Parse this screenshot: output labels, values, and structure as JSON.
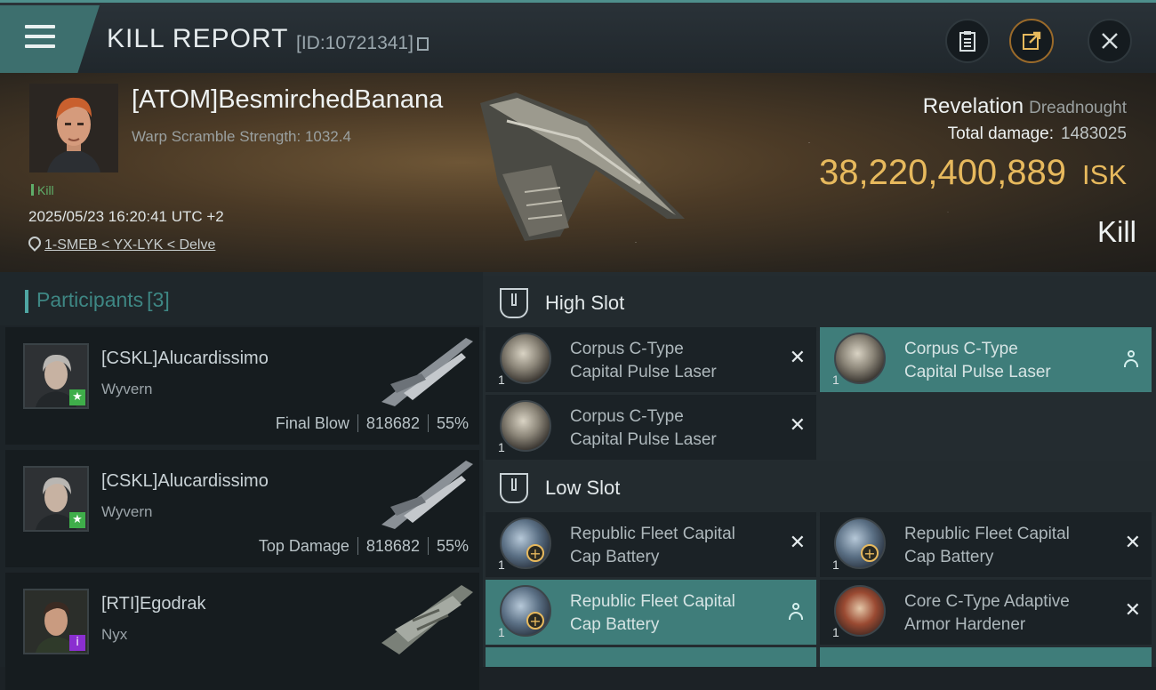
{
  "header": {
    "title": "KILL REPORT",
    "report_id": "[ID:10721341]"
  },
  "icons": {
    "menu": "hamburger-icon",
    "copy": "copy-icon",
    "clipboard": "clipboard-icon",
    "share": "share-icon",
    "close": "close-icon"
  },
  "victim": {
    "name": "[ATOM]BesmirchedBanana",
    "warp_scramble": "Warp Scramble Strength: 1032.4",
    "tag": "Kill",
    "timestamp": "2025/05/23 16:20:41 UTC +2",
    "location": "1-SMEB < YX-LYK < Delve",
    "ship": "Revelation",
    "ship_class": "Dreadnought",
    "total_damage_label": "Total damage:",
    "total_damage": "1483025",
    "isk_value": "38,220,400,889",
    "isk_unit": "ISK",
    "result": "Kill"
  },
  "participants": {
    "title": "Participants",
    "count": "[3]",
    "rows": [
      {
        "name": "[CSKL]Alucardissimo",
        "ship": "Wyvern",
        "role": "Final Blow",
        "damage": "818682",
        "percent": "55%",
        "badge": "★",
        "badge_color": "#3fae4a"
      },
      {
        "name": "[CSKL]Alucardissimo",
        "ship": "Wyvern",
        "role": "Top Damage",
        "damage": "818682",
        "percent": "55%",
        "badge": "★",
        "badge_color": "#3fae4a"
      },
      {
        "name": "[RTI]Egodrak",
        "ship": "Nyx",
        "badge": "i",
        "badge_color": "#8a2fd0"
      }
    ]
  },
  "fitting": {
    "high_slot": {
      "title": "High Slot",
      "modules": [
        {
          "line1": "Corpus C-Type",
          "line2": "Capital Pulse Laser",
          "qty": "1",
          "state": "destroyed"
        },
        {
          "line1": "Corpus C-Type",
          "line2": "Capital Pulse Laser",
          "qty": "1",
          "state": "dropped"
        },
        {
          "line1": "Corpus C-Type",
          "line2": "Capital Pulse Laser",
          "qty": "1",
          "state": "destroyed"
        }
      ]
    },
    "low_slot": {
      "title": "Low Slot",
      "modules": [
        {
          "line1": "Republic Fleet Capital",
          "line2": "Cap Battery",
          "qty": "1",
          "state": "destroyed"
        },
        {
          "line1": "Republic Fleet Capital",
          "line2": "Cap Battery",
          "qty": "1",
          "state": "destroyed"
        },
        {
          "line1": "Republic Fleet Capital",
          "line2": "Cap Battery",
          "qty": "1",
          "state": "dropped"
        },
        {
          "line1": "Core C-Type Adaptive",
          "line2": "Armor Hardener",
          "qty": "1",
          "state": "destroyed"
        }
      ]
    }
  },
  "colors": {
    "accent_teal": "#3f7d7a",
    "isk_gold": "#e7b95d",
    "kill_green": "#5fae6a"
  }
}
